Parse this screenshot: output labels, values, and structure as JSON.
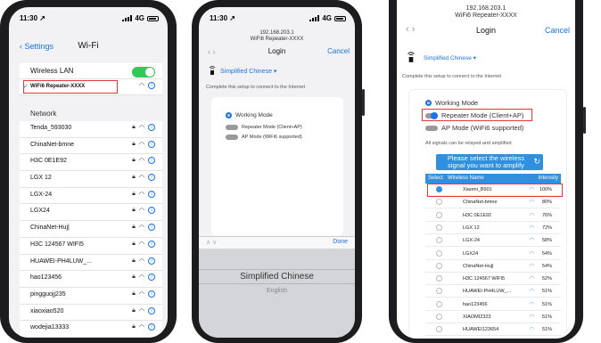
{
  "phone1": {
    "status": {
      "time": "11:30 ↗",
      "network": "4G"
    },
    "back_label": "Settings",
    "title": "Wi-Fi",
    "wlan_label": "Wireless LAN",
    "connected": "WiFi6 Repeater-XXXX",
    "network_header": "Network",
    "networks": [
      "Tenda_593030",
      "ChinaNet-bmne",
      "H3C 0E1E92",
      "LGX 12",
      "LGX-24",
      "LGX24",
      "ChinaNet-Huj|",
      "H3C 124567 WIFI5",
      "HUAWEI-PH4LUW_...",
      "hao123456",
      "pingguojj235",
      "xiaoxiao520",
      "wodejia13333"
    ]
  },
  "phone2": {
    "status": {
      "time": "11:30 ↗",
      "network": "4G"
    },
    "ip": "192.168.203.1",
    "device": "WiFi6 Repeater-XXXX",
    "title": "Login",
    "cancel": "Cancel",
    "arrows": "‹  ›",
    "language": "Simplified Chinese ▾",
    "hint": "Complete this setup to connect to the Internet",
    "working_mode": "Working Mode",
    "mode_repeater": "Repeater Mode (Client+AP)",
    "mode_ap": "AP Mode (WiFi6 supported)",
    "keybar_arrows": "∧ ∨",
    "done": "Done",
    "picker_selected": "Simplified Chinese",
    "picker_next": "English"
  },
  "phone3": {
    "ip": "192.168.203.1",
    "device": "WiFi6 Repeater-XXXX",
    "title": "Login",
    "cancel": "Cancel",
    "arrows": "‹  ›",
    "language": "Simplified Chinese ▾",
    "hint": "Complete this setup to connect to the Internet",
    "working_mode": "Working Mode",
    "mode_repeater": "Repeater Mode (Client+AP)",
    "mode_ap": "AP Mode (WiFi6 supported)",
    "relay_note": "All signals can be relayed and amplified",
    "scan_button": "Please select the wireless signal you want to amplify",
    "columns": {
      "select": "Select",
      "name": "Wireless Name",
      "intensity": "Intensity"
    },
    "rows": [
      {
        "name": "Xiaomi_B901",
        "pct": "100%"
      },
      {
        "name": "ChinaNet-bmne",
        "pct": "80%"
      },
      {
        "name": "H3C 0E1E92",
        "pct": "76%"
      },
      {
        "name": "LGX 12",
        "pct": "72%"
      },
      {
        "name": "LGX-24",
        "pct": "58%"
      },
      {
        "name": "LGX24",
        "pct": "54%"
      },
      {
        "name": "ChinaNet-Huj|",
        "pct": "54%"
      },
      {
        "name": "H3C 124567 WIFI5",
        "pct": "52%"
      },
      {
        "name": "HUAWEI-PH4LUW_...",
        "pct": "51%"
      },
      {
        "name": "hao123456",
        "pct": "51%"
      },
      {
        "name": "XIAOMI2323",
        "pct": "51%"
      },
      {
        "name": "HUAWEI123654",
        "pct": "51%"
      }
    ]
  }
}
